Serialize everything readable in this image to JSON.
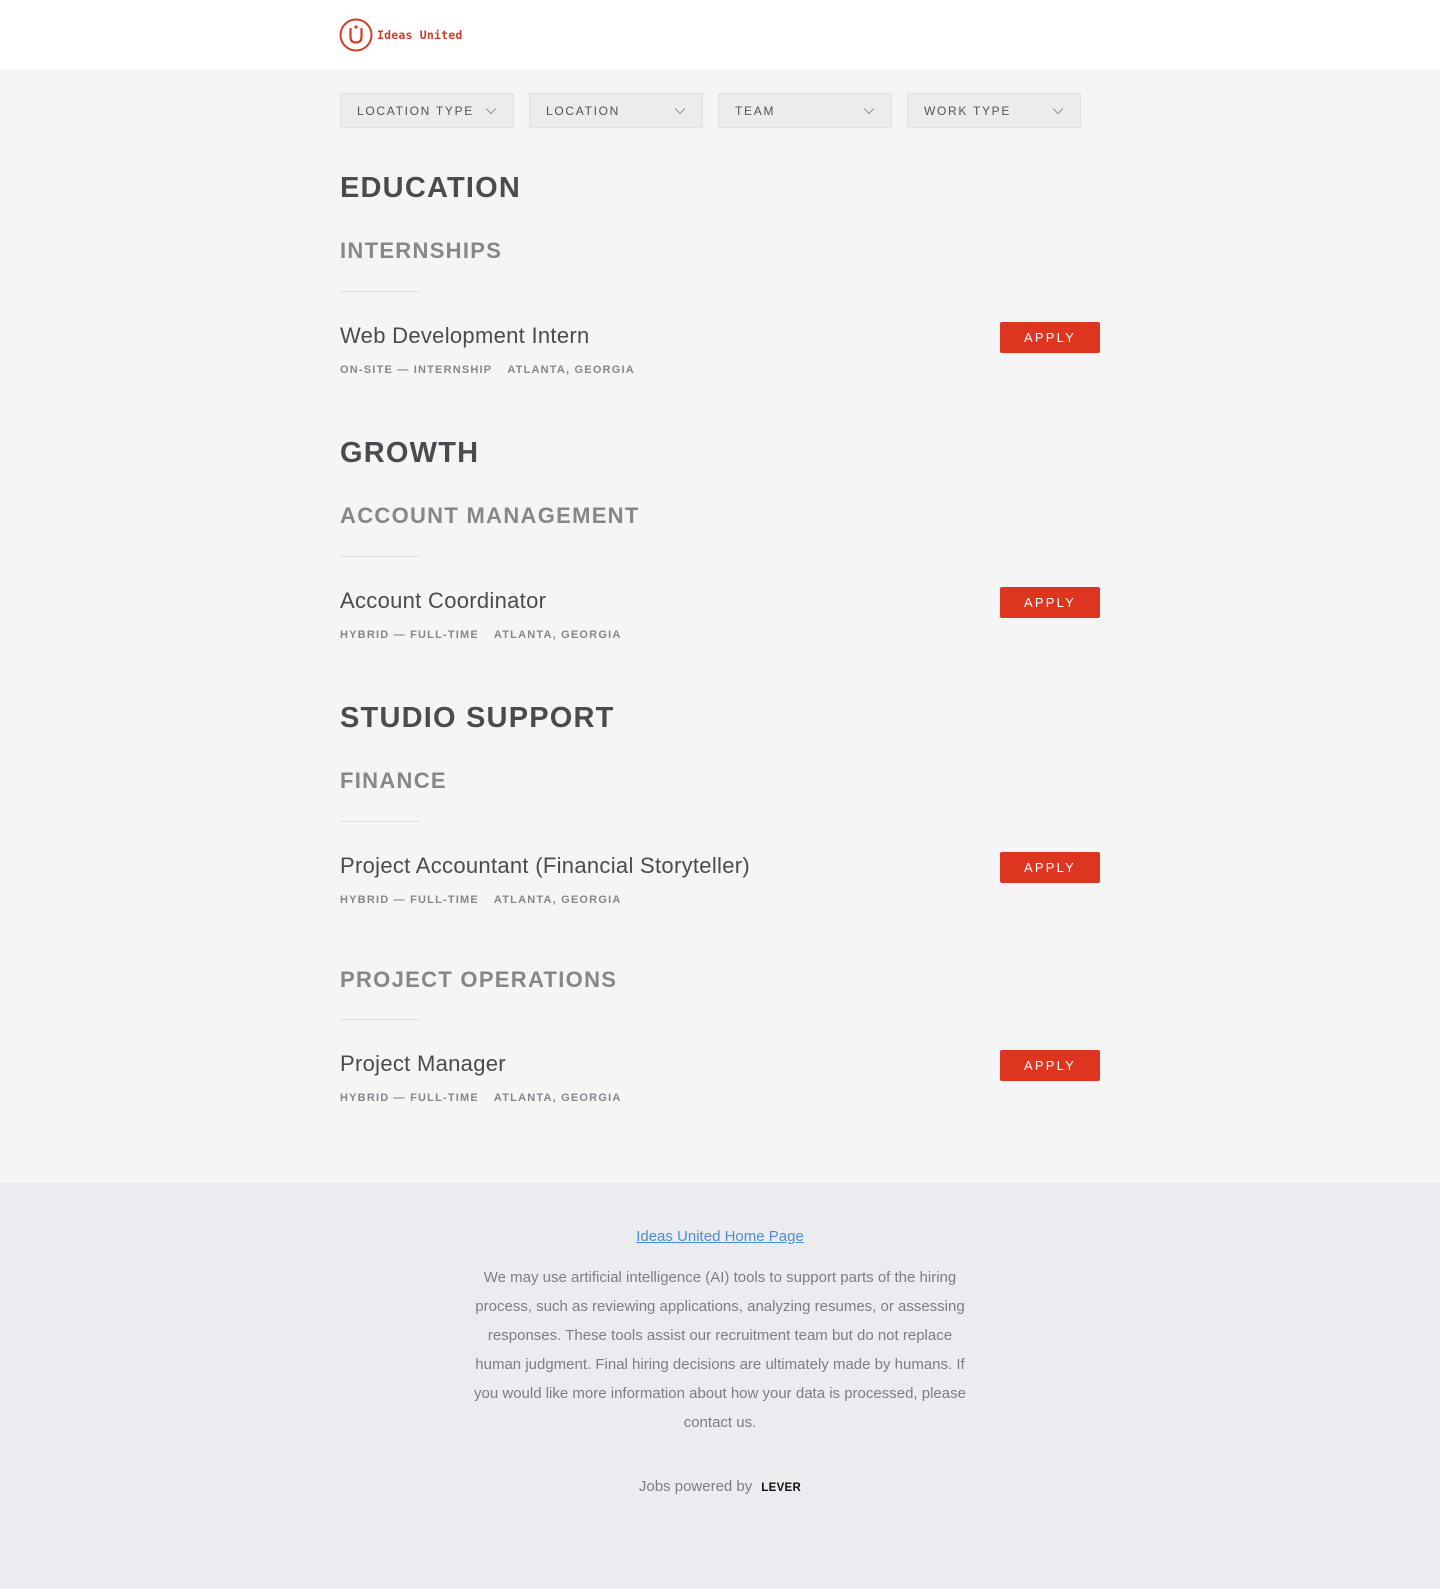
{
  "header": {
    "logo_text": "Ideas United",
    "brand_color": "#d63a25"
  },
  "filters": [
    {
      "label": "LOCATION TYPE",
      "icon": "chevron-down-icon"
    },
    {
      "label": "LOCATION",
      "icon": "chevron-down-icon"
    },
    {
      "label": "TEAM",
      "icon": "chevron-down-icon"
    },
    {
      "label": "WORK TYPE",
      "icon": "chevron-down-icon"
    }
  ],
  "departments": [
    {
      "name": "EDUCATION",
      "teams": [
        {
          "name": "INTERNSHIPS",
          "jobs": [
            {
              "title": "Web Development Intern",
              "commitment": "ON-SITE — INTERNSHIP",
              "location": "ATLANTA, GEORGIA",
              "apply_label": "APPLY"
            }
          ]
        }
      ]
    },
    {
      "name": "GROWTH",
      "teams": [
        {
          "name": "ACCOUNT MANAGEMENT",
          "jobs": [
            {
              "title": "Account Coordinator",
              "commitment": "HYBRID — FULL-TIME",
              "location": "ATLANTA, GEORGIA",
              "apply_label": "APPLY"
            }
          ]
        }
      ]
    },
    {
      "name": "STUDIO SUPPORT",
      "teams": [
        {
          "name": "FINANCE",
          "jobs": [
            {
              "title": "Project Accountant (Financial Storyteller)",
              "commitment": "HYBRID — FULL-TIME",
              "location": "ATLANTA, GEORGIA",
              "apply_label": "APPLY"
            }
          ]
        },
        {
          "name": "PROJECT OPERATIONS",
          "jobs": [
            {
              "title": "Project Manager",
              "commitment": "HYBRID — FULL-TIME",
              "location": "ATLANTA, GEORGIA",
              "apply_label": "APPLY"
            }
          ]
        }
      ]
    }
  ],
  "footer": {
    "home_link": "Ideas United Home Page",
    "disclaimer": "We may use artificial intelligence (AI) tools to support parts of the hiring process, such as reviewing applications, analyzing resumes, or assessing responses. These tools assist our recruitment team but do not replace human judgment. Final hiring decisions are ultimately made by humans. If you would like more information about how your data is processed, please contact us.",
    "powered_by": "Jobs powered by",
    "powered_brand": "LEVER"
  },
  "colors": {
    "apply_button": "#de3521",
    "link": "#4c8ed6",
    "page_background": "#f5f5f6",
    "footer_background": "#ebecf0"
  }
}
